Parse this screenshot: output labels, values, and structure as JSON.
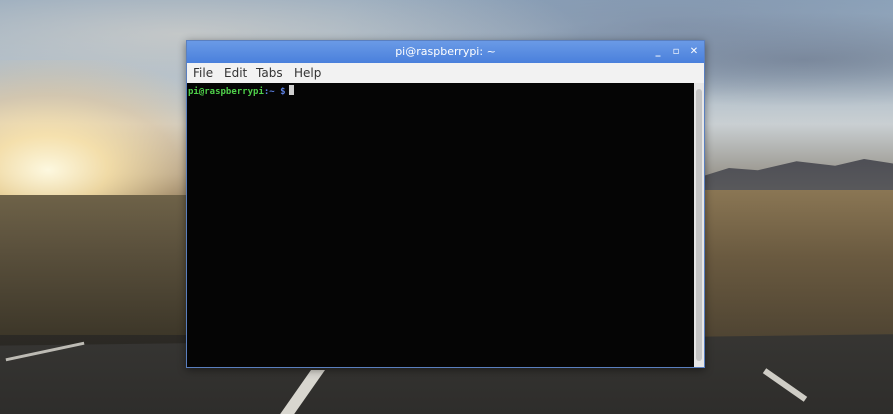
{
  "window": {
    "title": "pi@raspberrypi: ~",
    "controls": {
      "minimize": "_",
      "maximize": "▫",
      "close": "✕"
    }
  },
  "menubar": {
    "items": [
      "File",
      "Edit",
      "Tabs",
      "Help"
    ]
  },
  "terminal": {
    "prompt_user": "pi@raspberrypi",
    "prompt_path": ":~ $",
    "input": ""
  },
  "colors": {
    "titlebar": "#4a80dc",
    "terminal_bg": "#050505",
    "prompt_user": "#4fd04a",
    "prompt_path": "#5b7fe0"
  }
}
